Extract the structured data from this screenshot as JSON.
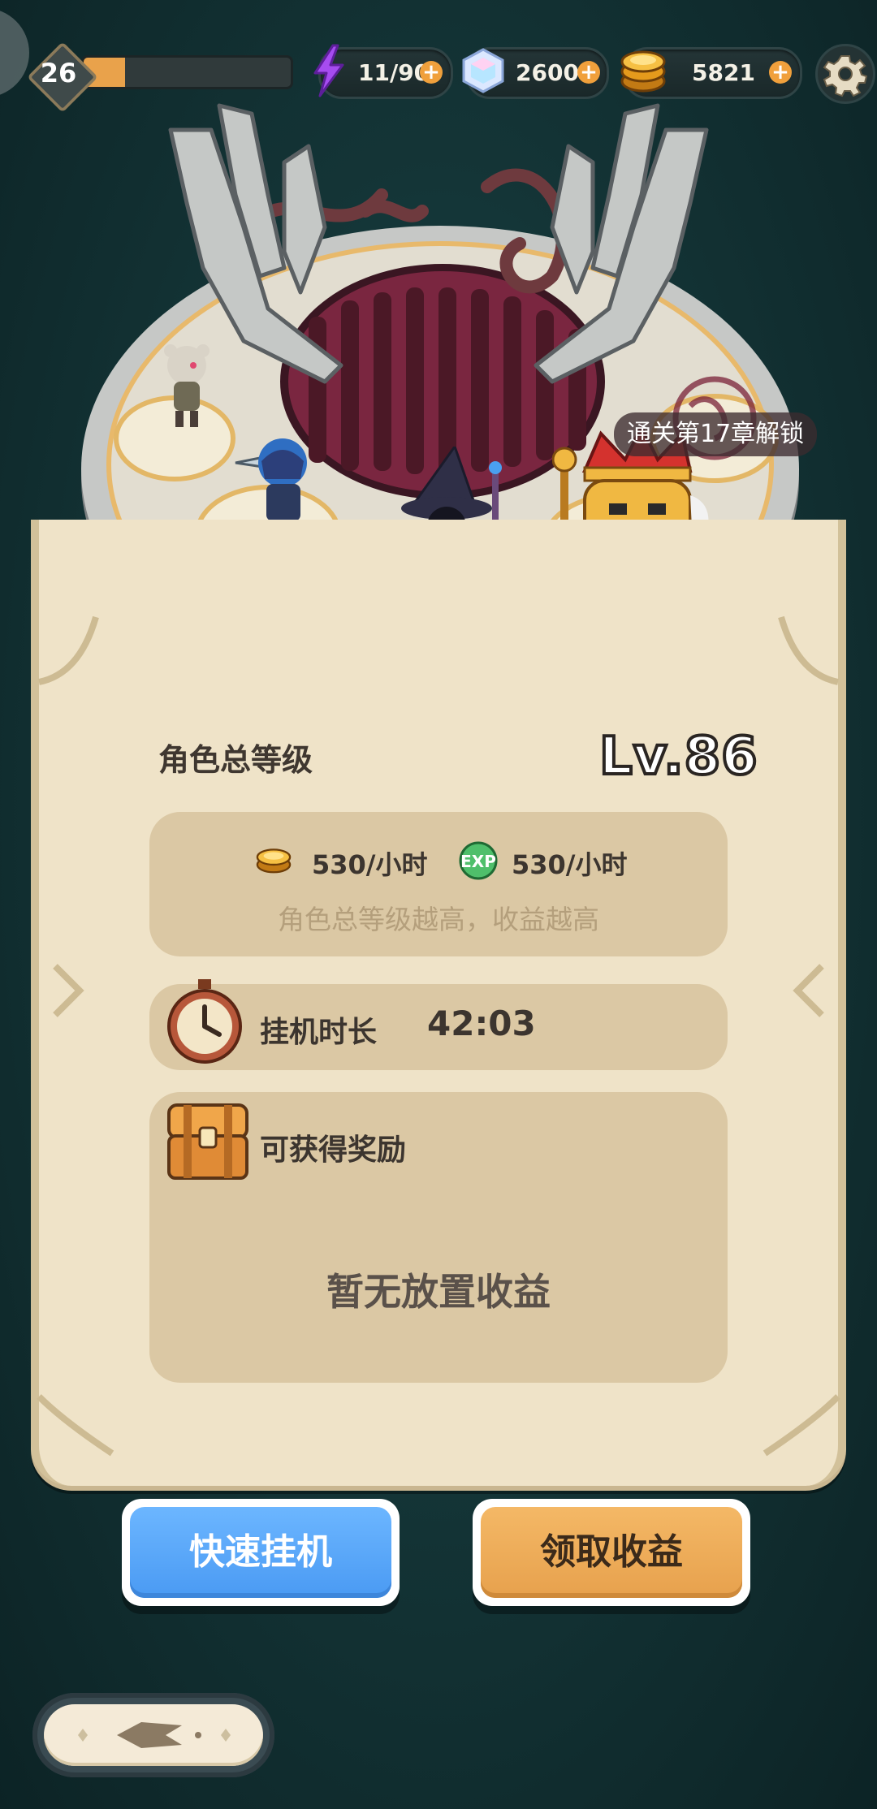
{
  "header": {
    "player_level": "26",
    "xp_progress": 0.2,
    "energy": "11/90",
    "gems": "2600",
    "gold": "5821"
  },
  "arena": {
    "locked_slot_text": "通关第17章解锁"
  },
  "panel": {
    "total_level_label": "角色总等级",
    "total_level_value": "Lv.86",
    "income": {
      "gold_rate": "530/小时",
      "exp_rate": "530/小时",
      "hint": "角色总等级越高，收益越高"
    },
    "idle": {
      "label": "挂机时长",
      "time": "42:03"
    },
    "reward": {
      "label": "可获得奖励",
      "empty_text": "暂无放置收益"
    }
  },
  "buttons": {
    "quick_idle": "快速挂机",
    "claim": "领取收益"
  },
  "colors": {
    "accent_blue": "#5aa8fb",
    "accent_orange": "#eaa755",
    "panel_bg": "#efe3c8",
    "box_bg": "#dbc8a4"
  }
}
